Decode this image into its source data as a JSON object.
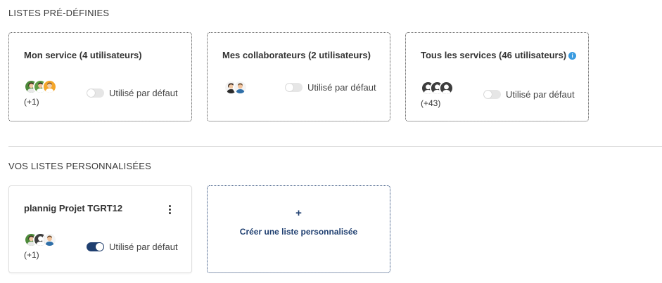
{
  "predefined": {
    "title": "LISTES PRÉ-DÉFINIES",
    "cards": [
      {
        "title": "Mon service (4 utilisateurs)",
        "more": "(+1)",
        "toggle_label": "Utilisé par défaut",
        "toggle_on": false
      },
      {
        "title": "Mes collaborateurs (2 utilisateurs)",
        "more": "",
        "toggle_label": "Utilisé par défaut",
        "toggle_on": false
      },
      {
        "title": "Tous les services (46 utilisateurs)",
        "info_icon": "i",
        "more": "(+43)",
        "toggle_label": "Utilisé par défaut",
        "toggle_on": false
      }
    ]
  },
  "custom": {
    "title": "VOS LISTES PERSONNALISÉES",
    "cards": [
      {
        "title": "plannig Projet TGRT12",
        "more": "(+1)",
        "toggle_label": "Utilisé par défaut",
        "toggle_on": true
      }
    ],
    "create": {
      "plus": "+",
      "label": "Créer une liste personnalisée"
    }
  },
  "colors": {
    "accent": "#1f3f70",
    "info": "#3a9be0"
  }
}
